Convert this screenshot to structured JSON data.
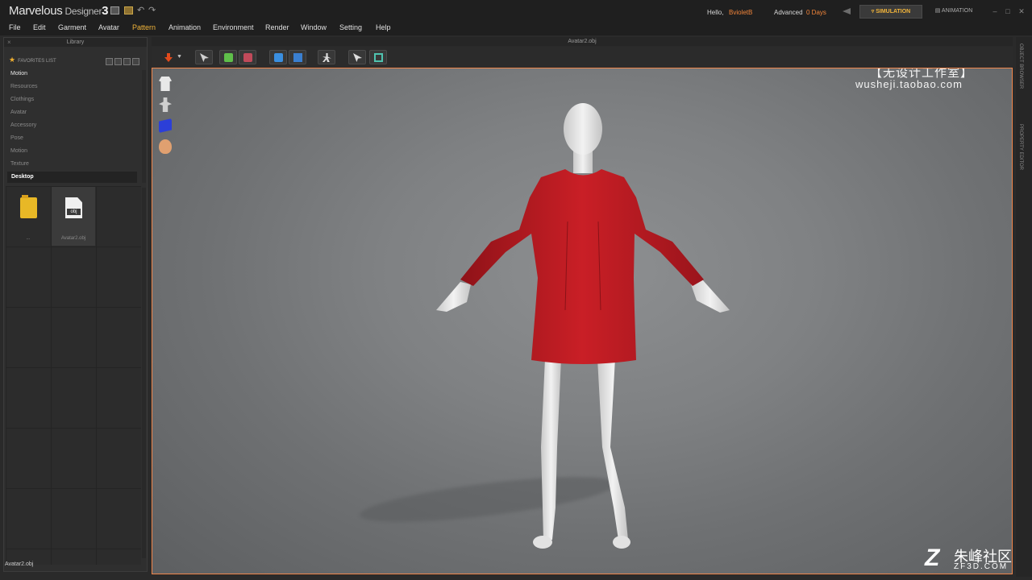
{
  "app": {
    "logo_main": "Marvelous",
    "logo_sub": " Designer",
    "logo_version": "3"
  },
  "header": {
    "hello": "Hello,",
    "username": "BvioletB",
    "license": "Advanced",
    "days": "0 Days",
    "mode_simulation": "SIMULATION",
    "mode_animation": "ANIMATION"
  },
  "menu": {
    "items": [
      "File",
      "Edit",
      "Garment",
      "Avatar",
      "Pattern",
      "Animation",
      "Environment",
      "Render",
      "Window",
      "Setting",
      "Help"
    ],
    "active": "Pattern"
  },
  "library": {
    "title": "Library",
    "favorites_label": "FAVORITES LIST",
    "categories": [
      "Motion",
      "Resources",
      "Clothings",
      "Avatar",
      "Accessory",
      "Pose",
      "Motion",
      "Texture"
    ],
    "selected_category": "Desktop",
    "tiles": [
      {
        "label": "...",
        "type": "folder"
      },
      {
        "label": "Avatar2.obj",
        "type": "file",
        "badge": "obj"
      }
    ],
    "status_file": "Avatar2.obj"
  },
  "viewport": {
    "title": "Avatar2.obj",
    "watermark_cn": "【无设计工作室】",
    "watermark_url": "wusheji.taobao.com",
    "accent_color": "#f0864b",
    "garment_color": "#c21c22"
  },
  "right_panel": {
    "object_browser": "OBJECT BROWSER",
    "property_editor": "PROPERTY EDITOR"
  },
  "corner_logo": {
    "mark": "Z",
    "name_cn": "朱峰社区",
    "site": "ZF3D.COM"
  }
}
